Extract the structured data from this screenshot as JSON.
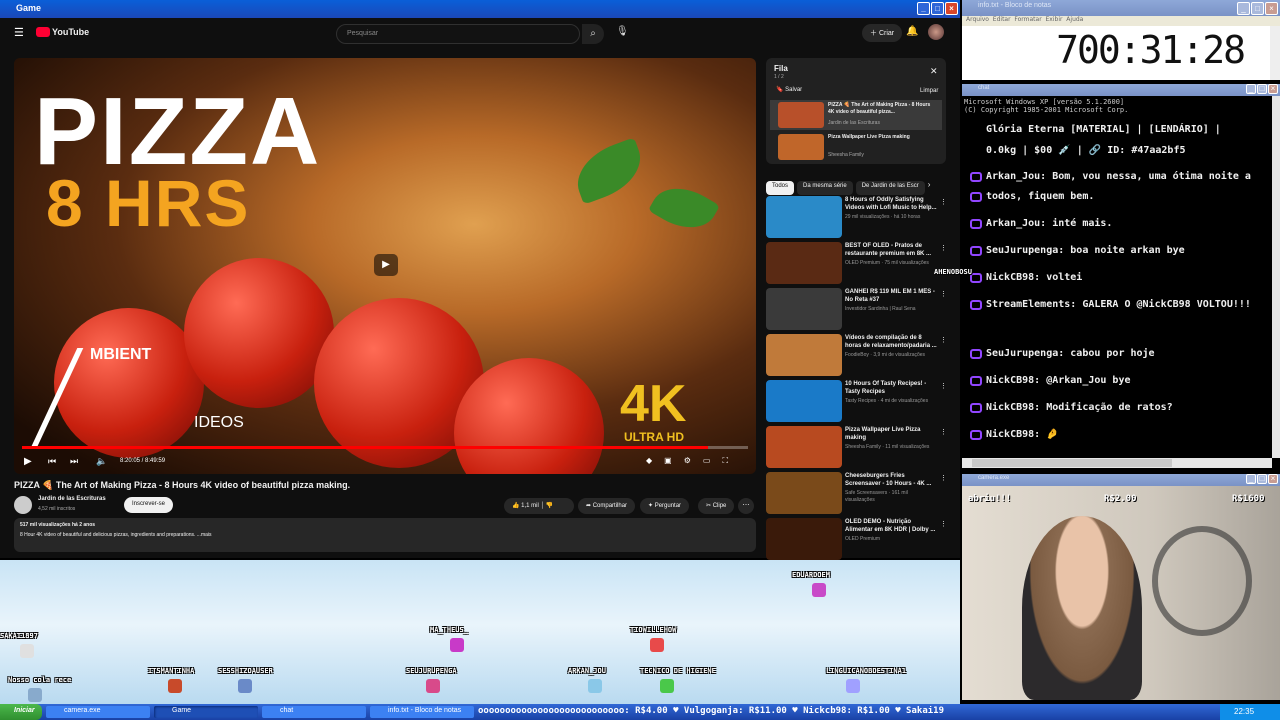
{
  "game_window": {
    "title": "Game"
  },
  "youtube": {
    "search_placeholder": "Pesquisar",
    "create_label": "Criar",
    "video_title": "PIZZA 🍕 The Art of Making Pizza - 8 Hours 4K video of beautiful pizza making.",
    "thumb_word": "PIZZA",
    "thumb_hours": "8 HRS",
    "thumb_brand": "MBIENT",
    "thumb_brand2": "IDEOS",
    "thumb_4k": "4K",
    "thumb_uhd": "ULTRA HD",
    "time": "8:20:05 / 8:49:59",
    "progress_fraction": 0.945,
    "channel": "Jardin de las Escrituras",
    "subs": "4,52 mil inscritos",
    "subscribe": "Inscrever-se",
    "likes": "1,1 mil",
    "share": "Compartilhar",
    "ask": "Perguntar",
    "clip": "Clipe",
    "views_line": "517 mil visualizações  há 2 anos",
    "desc_line": "8 Hour 4K video of beautiful and delicious pizzas, ingredients and preparations. ...mais",
    "queue": {
      "title": "Fila",
      "count": "1 / 2",
      "save": "Salvar",
      "clear": "Limpar",
      "items": [
        {
          "title": "PIZZA 🍕 The Art of Making Pizza - 8 Hours 4K video of beautiful pizza...",
          "channel": "Jardin de las Escrituras"
        },
        {
          "title": "Pizza Wallpaper Live Pizza making",
          "channel": "Sheesha Family"
        }
      ]
    },
    "chips": [
      "Todos",
      "Da mesma série",
      "De Jardin de las Escr"
    ],
    "recs": [
      {
        "title": "8 Hours of Oddly Satisfying Videos with Lofi Music to Help...",
        "meta": "29 mil visualizações · há 10 horas",
        "color": "#2a8ac8"
      },
      {
        "title": "BEST OF OLED - Pratos de restaurante premium em 8K ...",
        "meta": "OLED Premium · 75 mil visualizações",
        "color": "#5a2a14"
      },
      {
        "title": "GANHEI R$ 119 MIL EM 1 MÊS - No Reta #37",
        "meta": "Investidor Sardinha | Raul Sena",
        "color": "#3a3a3a"
      },
      {
        "title": "Vídeos de compilação de 8 horas de relaxamento/padaria ...",
        "meta": "FoodieBoy · 3,9 mi de visualizações",
        "color": "#c07a3a"
      },
      {
        "title": "10 Hours Of Tasty Recipes! - Tasty Recipes",
        "meta": "Tasty Recipes · 4 mi de visualizações",
        "color": "#1a7ac8"
      },
      {
        "title": "Pizza Wallpaper Live Pizza making",
        "meta": "Sheesha Family · 11 mil visualizações",
        "color": "#b84a20"
      },
      {
        "title": "Cheeseburgers Fries Screensaver - 10 Hours - 4K ...",
        "meta": "Safe Screensavers · 161 mil visualizações",
        "color": "#7a4a1a"
      },
      {
        "title": "OLED DEMO - Nutrição Alimentar em 8K HDR | Dolby ...",
        "meta": "OLED Premium",
        "color": "#3a1a0a"
      }
    ]
  },
  "notepad": {
    "title": "info.txt - Bloco de notas",
    "menu": [
      "Arquivo",
      "Editar",
      "Formatar",
      "Exibir",
      "Ajuda"
    ],
    "timer": "700:31:28"
  },
  "cmd": {
    "title": "chat",
    "header1": "Microsoft Windows XP [versão 5.1.2600]",
    "header2": "(C) Copyright 1985-2001 Microsoft Corp.",
    "lines": [
      "Glória Eterna [MATERIAL] | [LENDÁRIO] |",
      "0.0kg | $00 💉 | 🔗 ID: #47aa2bf5",
      "Arkan_Jou: Bom, vou nessa, uma ótima noite a",
      "todos, fiquem bem.",
      "Arkan_Jou: inté mais.",
      "SeuJurupenga: boa noite arkan bye",
      "NickCB98: voltei",
      "StreamElements: GALERA O @NickCB98 VOLTOU!!!",
      "SeuJurupenga: cabou por hoje",
      "NickCB98: @Arkan_Jou bye",
      "NickCB98: Modificação de ratos?",
      "NickCB98: 🤌"
    ],
    "overlay_label": "AHENOBOSU"
  },
  "camera": {
    "title": "camera.exe",
    "label_left": "abriu!!!",
    "label_mid": "R$2.00",
    "label_right": "R$1600"
  },
  "avatars": [
    {
      "name": "SAKAI1897"
    },
    {
      "name": "ITSMANTINHA"
    },
    {
      "name": "SESSHIZOAUSER"
    },
    {
      "name": "MA_THEUS_"
    },
    {
      "name": "SEUJURUPENGA"
    },
    {
      "name": "ARKAN_JOU"
    },
    {
      "name": "TECNICO DE HIGIENE"
    },
    {
      "name": "TIOWILLEHOW"
    },
    {
      "name": "EDUARDOEM"
    },
    {
      "name": "LINGUICANOBDESTINA1"
    },
    {
      "name": "Nosso cola\nrece"
    }
  ],
  "taskbar": {
    "start": "Iniciar",
    "items": [
      "camera.exe",
      "Game",
      "chat",
      "info.txt - Bloco de notas"
    ],
    "ticker": "ooooooooooooooooooooooooooo: R$4.00  ♥ Vulgoganja: R$11.00  ♥ Nickcb98: R$1.00  ♥ Sakai19",
    "clock": "22:35"
  }
}
